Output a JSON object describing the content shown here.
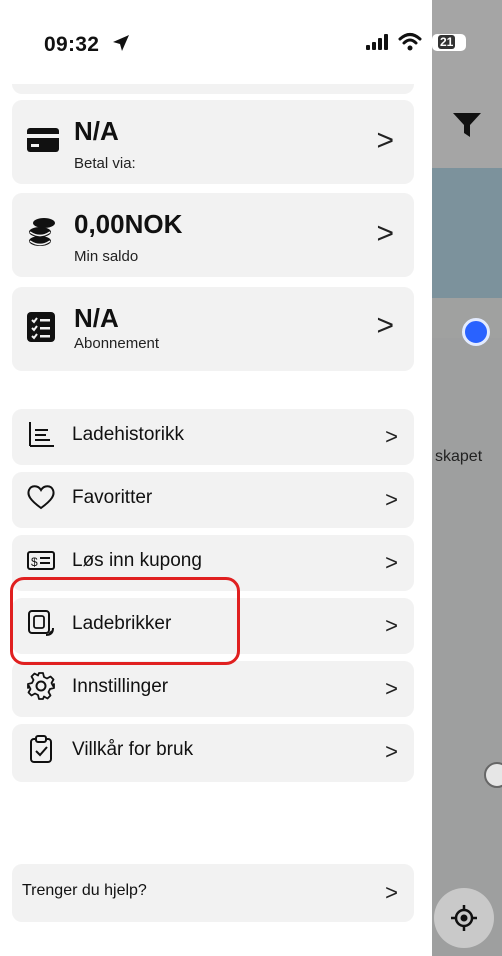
{
  "status_bar": {
    "time": "09:32",
    "battery": "21"
  },
  "summary_cards": [
    {
      "title": "N/A",
      "subtitle": "Betal via:",
      "icon": "credit-card-icon"
    },
    {
      "title": "0,00NOK",
      "subtitle": "Min saldo",
      "icon": "coins-icon"
    },
    {
      "title": "N/A",
      "subtitle": "Abonnement",
      "icon": "checklist-icon"
    }
  ],
  "menu_items": [
    {
      "label": "Ladehistorikk",
      "icon": "chart-history-icon"
    },
    {
      "label": "Favoritter",
      "icon": "heart-icon"
    },
    {
      "label": "Løs inn kupong",
      "icon": "coupon-icon"
    },
    {
      "label": "Ladebrikker",
      "icon": "charge-tag-icon"
    },
    {
      "label": "Innstillinger",
      "icon": "gear-icon"
    },
    {
      "label": "Villkår for bruk",
      "icon": "clipboard-check-icon"
    }
  ],
  "help": {
    "label": "Trenger du hjelp?"
  },
  "map": {
    "label": "skapet"
  },
  "chevron": ">",
  "colors": {
    "card_bg": "#f2f2f2",
    "highlight": "#e02020",
    "map_dot": "#2962ff"
  }
}
